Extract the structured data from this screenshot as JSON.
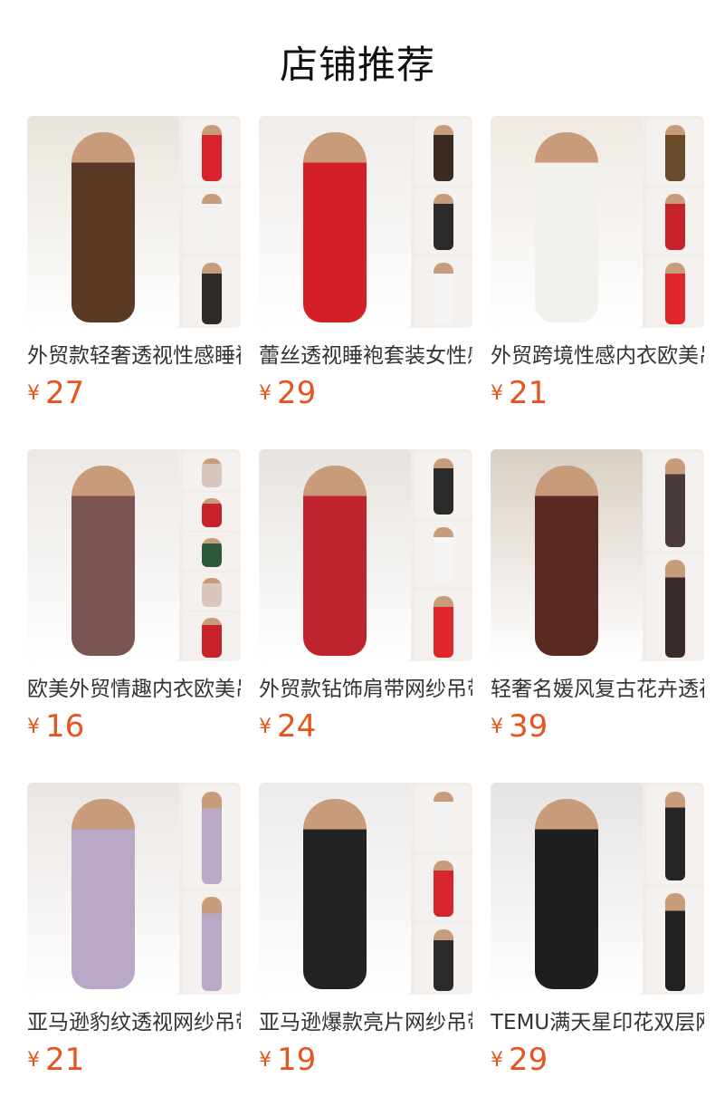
{
  "section": {
    "title": "店铺推荐"
  },
  "products": [
    {
      "title": "外贸款轻奢透视性感睡袍",
      "currency": "¥",
      "price": "27",
      "bg": "#e9e4dc",
      "dress": "#5a3a24",
      "side": [
        "#d8232a",
        "#f4f2ee",
        "#2e2a28"
      ]
    },
    {
      "title": "蕾丝透视睡袍套装女性感",
      "currency": "¥",
      "price": "29",
      "bg": "#f0ece8",
      "dress": "#d51f26",
      "side": [
        "#3b2a22",
        "#2a2a2a",
        "#f5f5f5"
      ]
    },
    {
      "title": "外贸跨境性感内衣欧美吊带",
      "currency": "¥",
      "price": "21",
      "bg": "#efe9e2",
      "dress": "#f3f1ec",
      "side": [
        "#6b4a2a",
        "#c8232c",
        "#e0262a"
      ]
    },
    {
      "title": "欧美外贸情趣内衣欧美吊带",
      "currency": "¥",
      "price": "16",
      "bg": "#ece8e4",
      "dress": "#7a5552",
      "side": [
        "#d9c7bd",
        "#c8232c",
        "#2a5a3a"
      ]
    },
    {
      "title": "外贸款钻饰肩带网纱吊带裙",
      "currency": "¥",
      "price": "24",
      "bg": "#e7e3de",
      "dress": "#c0242c",
      "side": [
        "#2a2a2a",
        "#f5f5f5",
        "#e0262a"
      ]
    },
    {
      "title": "轻奢名媛风复古花卉透视睡袍",
      "currency": "¥",
      "price": "39",
      "bg": "#d9cfc4",
      "dress": "#5a2a22",
      "side": [
        "#4a3a3a",
        "#3a2a2a",
        "#3a2a2a"
      ]
    },
    {
      "title": "亚马逊豹纹透视网纱吊带裙",
      "currency": "¥",
      "price": "21",
      "bg": "#eae6e3",
      "dress": "#b9a8c8",
      "side": [
        "#b9a8c8",
        "#b9a8c8",
        "#b9a8c8"
      ]
    },
    {
      "title": "亚马逊爆款亮片网纱吊带裙",
      "currency": "¥",
      "price": "19",
      "bg": "#ecebea",
      "dress": "#222222",
      "side": [
        "#f2f2f2",
        "#d5262c",
        "#2a2a2a"
      ]
    },
    {
      "title": "TEMU满天星印花双层网纱裙",
      "currency": "¥",
      "price": "29",
      "bg": "#e6e4e2",
      "dress": "#1e1e1e",
      "side": [
        "#262626",
        "#222222",
        "#222222"
      ]
    }
  ]
}
